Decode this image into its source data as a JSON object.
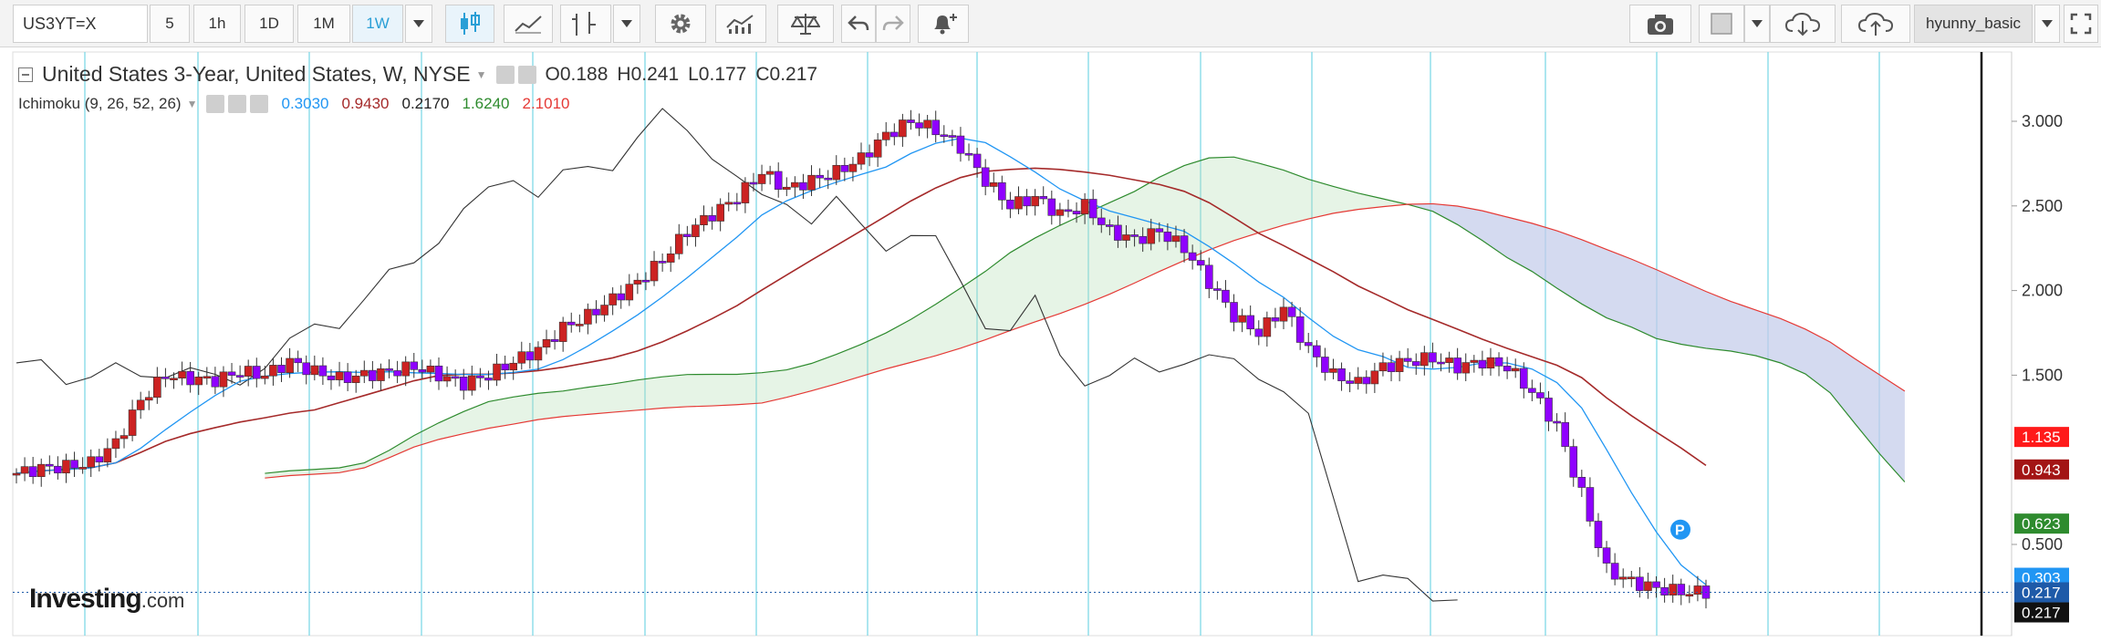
{
  "toolbar": {
    "symbol": "US3YT=X",
    "intervals": [
      "5",
      "1h",
      "1D",
      "1M",
      "1W"
    ],
    "active_interval": "1W",
    "user": "hyunny_basic"
  },
  "legend": {
    "title": "United States 3-Year, United States, W, NYSE",
    "open": "O0.188",
    "high": "H0.241",
    "low": "L0.177",
    "close": "C0.217",
    "indicator": "Ichimoku (9, 26, 52, 26)",
    "values": [
      {
        "text": "0.3030",
        "color": "#2196f3"
      },
      {
        "text": "0.9430",
        "color": "#a52a2a"
      },
      {
        "text": "0.2170",
        "color": "#222222"
      },
      {
        "text": "1.6240",
        "color": "#2e8b2e"
      },
      {
        "text": "2.1010",
        "color": "#e53935"
      }
    ]
  },
  "logo": {
    "main": "Investing",
    "suffix": ".com"
  },
  "chart_data": {
    "type": "candlestick",
    "title": "United States 3-Year, United States, W, NYSE",
    "indicator": "Ichimoku (9, 26, 52, 26)",
    "y_ticks": [
      "3.000",
      "2.500",
      "2.000",
      "1.500",
      "0.500"
    ],
    "ylim": [
      0.1,
      3.4
    ],
    "last_ohlc": {
      "open": 0.188,
      "high": 0.241,
      "low": 0.177,
      "close": 0.217
    },
    "price_close_approx": [
      0.92,
      0.95,
      0.96,
      0.98,
      1.1,
      1.35,
      1.5,
      1.48,
      1.47,
      1.52,
      1.5,
      1.58,
      1.52,
      1.48,
      1.5,
      1.52,
      1.55,
      1.5,
      1.45,
      1.5,
      1.58,
      1.65,
      1.78,
      1.85,
      1.95,
      2.05,
      2.18,
      2.35,
      2.45,
      2.55,
      2.7,
      2.6,
      2.65,
      2.7,
      2.78,
      2.92,
      3.0,
      2.95,
      2.85,
      2.65,
      2.5,
      2.55,
      2.45,
      2.5,
      2.35,
      2.3,
      2.35,
      2.25,
      2.05,
      1.85,
      1.75,
      1.9,
      1.65,
      1.5,
      1.45,
      1.55,
      1.58,
      1.6,
      1.55,
      1.58,
      1.55,
      1.4,
      1.2,
      0.8,
      0.35,
      0.28,
      0.24,
      0.22,
      0.217
    ],
    "price_labels": [
      {
        "text": "1.135",
        "bg": "#ff1a1a",
        "color": "#ffffff"
      },
      {
        "text": "0.943",
        "bg": "#a31515",
        "color": "#ffffff"
      },
      {
        "text": "0.623",
        "bg": "#2e8b2e",
        "color": "#ffffff"
      },
      {
        "text": "0.303",
        "bg": "#2196f3",
        "color": "#ffffff"
      },
      {
        "text": "0.217",
        "bg": "#1e5aa8",
        "color": "#ffffff"
      },
      {
        "text": "0.217",
        "bg": "#111111",
        "color": "#ffffff"
      }
    ],
    "marker": "P",
    "colors": {
      "up": "#cc2222",
      "down": "#8f00ff",
      "tenkan": "#2196f3",
      "kijun": "#a52a2a",
      "chikou": "#333333",
      "grid": "#7fd8e6"
    }
  }
}
